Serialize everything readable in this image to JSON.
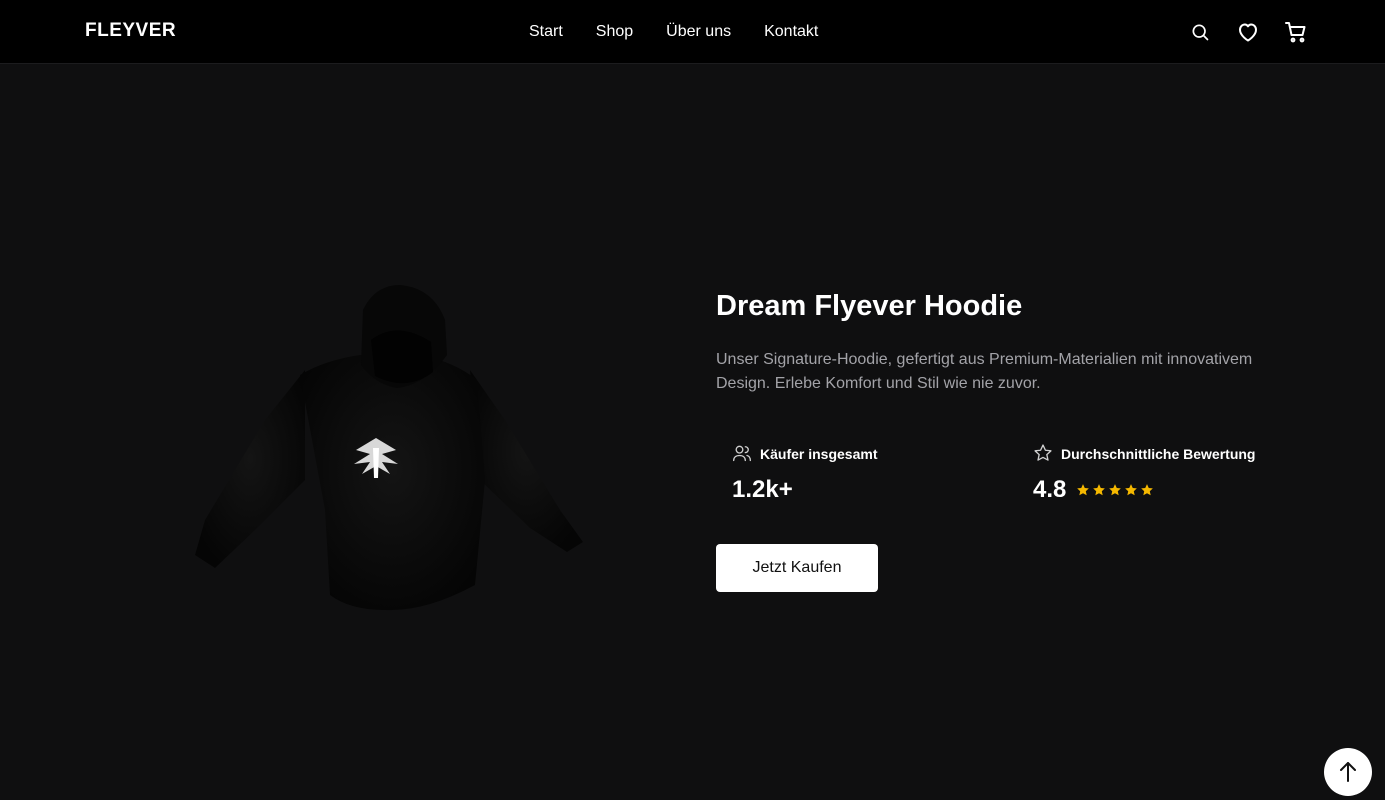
{
  "brand": {
    "logo": "FLEYVER"
  },
  "nav": {
    "links": [
      {
        "label": "Start"
      },
      {
        "label": "Shop"
      },
      {
        "label": "Über uns"
      },
      {
        "label": "Kontakt"
      }
    ],
    "icons": [
      "search-icon",
      "heart-icon",
      "cart-icon"
    ]
  },
  "product": {
    "title": "Dream Flyever Hoodie",
    "description": "Unser Signature-Hoodie, gefertigt aus Premium-Materialien mit innovativem Design. Erlebe Komfort und Stil wie nie zuvor.",
    "image_icon": "hoodie-image",
    "stats": {
      "buyers": {
        "label": "Käufer insgesamt",
        "value": "1.2k+",
        "icon": "users-icon"
      },
      "rating": {
        "label": "Durchschnittliche Bewertung",
        "value": "4.8",
        "icon": "star-outline-icon",
        "stars": 5,
        "star_color": "#f5b800"
      }
    },
    "cta_label": "Jetzt Kaufen"
  },
  "scroll_top": {
    "icon": "arrow-up-icon"
  },
  "colors": {
    "background": "#0f0f10",
    "navbar": "#000000",
    "text": "#ffffff",
    "muted_text": "#a3a3a8",
    "button_bg": "#ffffff",
    "star": "#f5b800"
  }
}
